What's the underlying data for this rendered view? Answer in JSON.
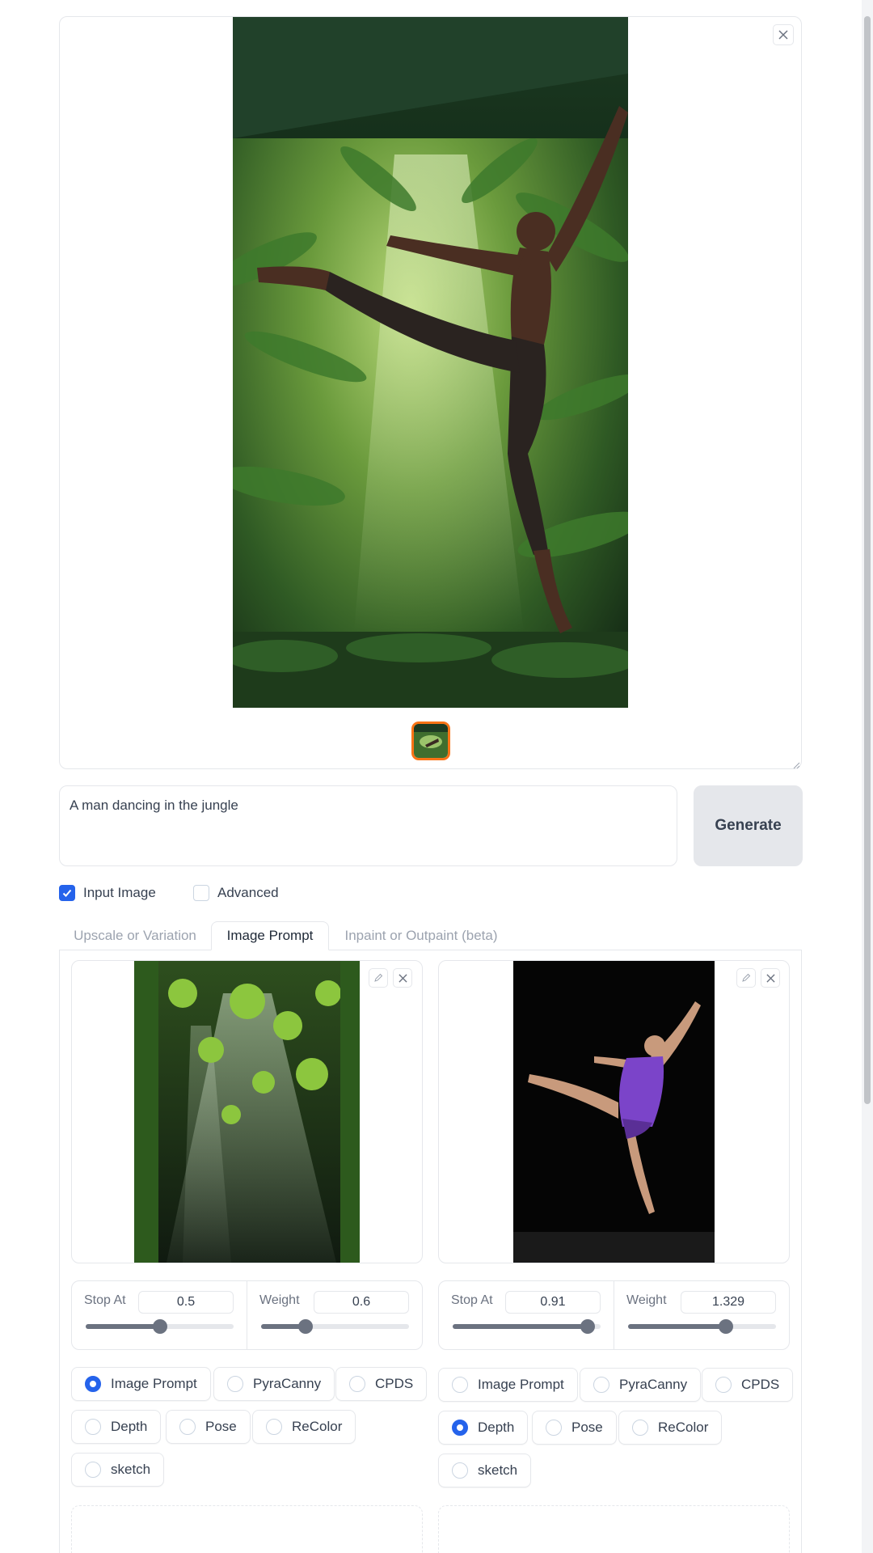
{
  "gallery": {
    "close_icon": "close-icon",
    "thumbnail_icon": "image-thumbnail"
  },
  "prompt": {
    "value": "A man dancing in the jungle",
    "generate_label": "Generate"
  },
  "options": {
    "input_image": {
      "label": "Input Image",
      "checked": true
    },
    "advanced": {
      "label": "Advanced",
      "checked": false
    }
  },
  "tabs": [
    {
      "label": "Upscale or Variation",
      "active": false
    },
    {
      "label": "Image Prompt",
      "active": true
    },
    {
      "label": "Inpaint or Outpaint (beta)",
      "active": false
    }
  ],
  "image_prompts": [
    {
      "stop_at_label": "Stop At",
      "stop_at": "0.5",
      "stop_at_fraction": 0.5,
      "weight_label": "Weight",
      "weight": "0.6",
      "weight_fraction": 0.3,
      "types": [
        "Image Prompt",
        "PyraCanny",
        "CPDS",
        "Depth",
        "Pose",
        "ReColor",
        "sketch"
      ],
      "selected": "Image Prompt"
    },
    {
      "stop_at_label": "Stop At",
      "stop_at": "0.91",
      "stop_at_fraction": 0.91,
      "weight_label": "Weight",
      "weight": "1.329",
      "weight_fraction": 0.66,
      "types": [
        "Image Prompt",
        "PyraCanny",
        "CPDS",
        "Depth",
        "Pose",
        "ReColor",
        "sketch"
      ],
      "selected": "Depth"
    }
  ],
  "colors": {
    "accent": "#2563eb",
    "thumb_border": "#f97316"
  }
}
